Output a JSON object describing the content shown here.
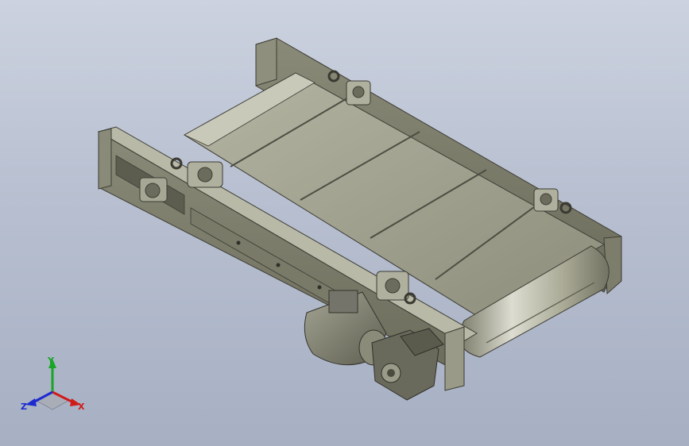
{
  "app": {
    "kind": "CAD 3D viewport"
  },
  "viewport": {
    "background_top": "#ccd2df",
    "background_bottom": "#a7b0c3",
    "model_color": "#9a9a86",
    "model_shadow": "#6d6d5c",
    "model_highlight": "#d9d9cc"
  },
  "triad": {
    "x_label": "X",
    "y_label": "Y",
    "z_label": "Z",
    "x_color": "#d01a1a",
    "y_color": "#19a526",
    "z_color": "#1c2ad0"
  },
  "icons": {
    "model": "belt-conveyor-assembly",
    "triad": "axis-triad-icon"
  }
}
